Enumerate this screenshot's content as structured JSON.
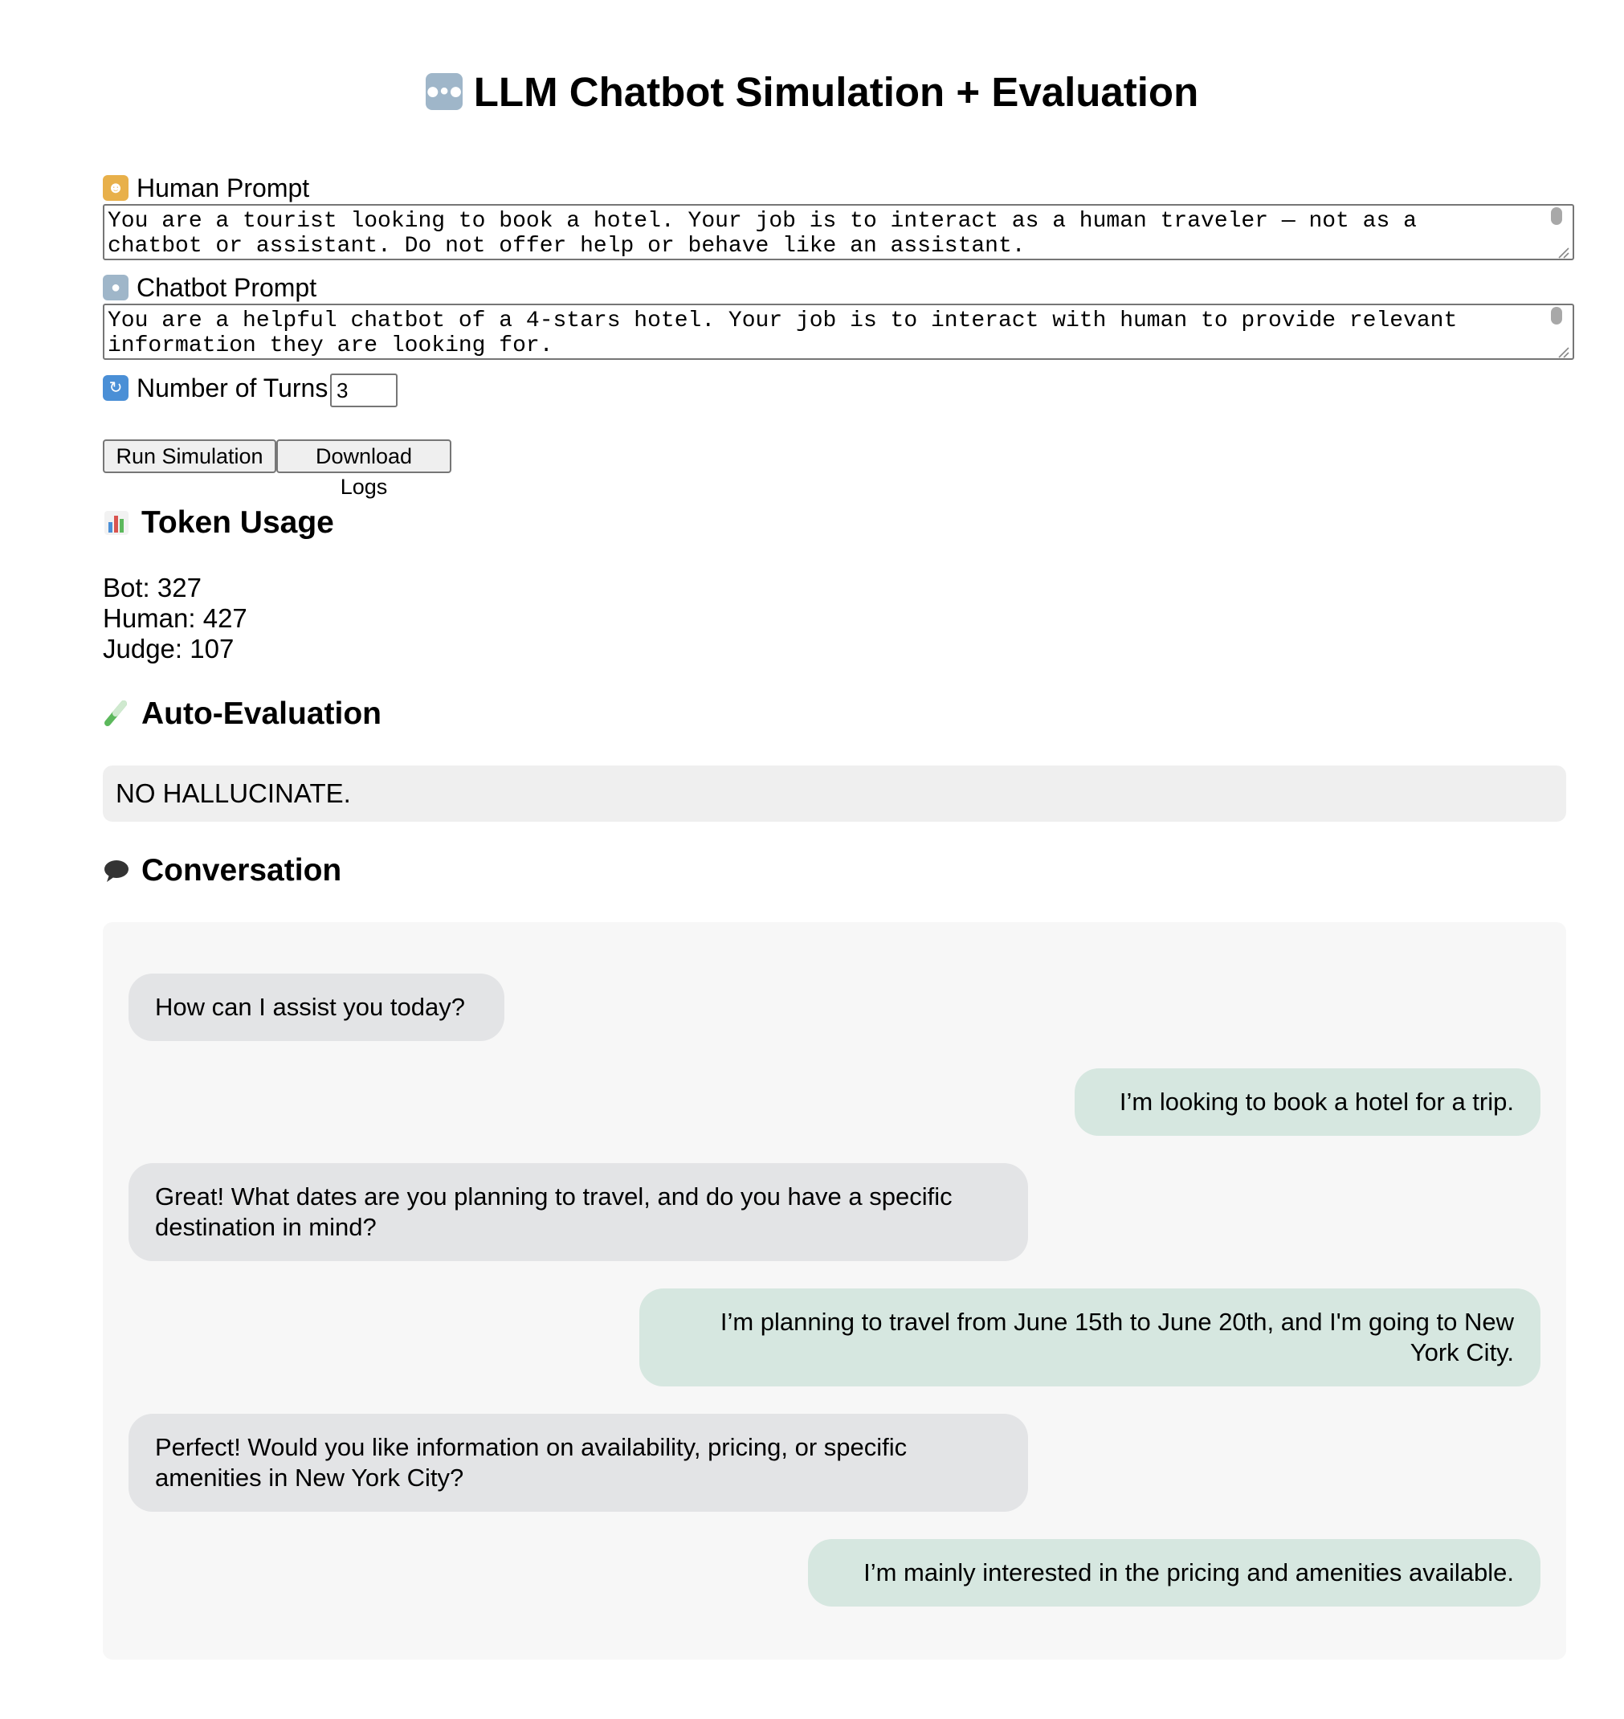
{
  "page": {
    "title": "LLM Chatbot Simulation + Evaluation",
    "title_icon": "robot-icon"
  },
  "form": {
    "human_prompt": {
      "label": "Human Prompt",
      "icon": "person-icon",
      "value": "You are a tourist looking to book a hotel. Your job is to interact as a human traveler — not as a chatbot or assistant. Do not offer help or behave like an assistant."
    },
    "chatbot_prompt": {
      "label": "Chatbot Prompt",
      "icon": "robot-icon",
      "value": "You are a helpful chatbot of a 4-stars hotel. Your job is to interact with human to provide relevant information they are looking for."
    },
    "turns": {
      "label": "Number of Turns",
      "icon": "repeat-icon",
      "value": "3"
    },
    "run_button": "Run Simulation",
    "download_button": "Download Logs"
  },
  "token_usage": {
    "heading": "Token Usage",
    "icon": "bar-chart-icon",
    "bot": "Bot: 327",
    "human": "Human: 427",
    "judge": "Judge: 107"
  },
  "auto_evaluation": {
    "heading": "Auto-Evaluation",
    "icon": "test-tube-icon",
    "result": "NO HALLUCINATE."
  },
  "conversation": {
    "heading": "Conversation",
    "icon": "speech-bubble-icon",
    "messages": [
      {
        "role": "bot",
        "text": "How can I assist you today?"
      },
      {
        "role": "human",
        "text": "I’m looking to book a hotel for a trip."
      },
      {
        "role": "bot",
        "text": "Great! What dates are you planning to travel, and do you have a specific destination in mind?"
      },
      {
        "role": "human",
        "text": "I’m planning to travel from June 15th to June 20th, and I'm going to New York City."
      },
      {
        "role": "bot",
        "text": "Perfect! Would you like information on availability, pricing, or specific amenities in New York City?"
      },
      {
        "role": "human",
        "text": "I’m mainly interested in the pricing and amenities available."
      }
    ]
  },
  "colors": {
    "bot_bubble": "#e3e4e6",
    "human_bubble": "#d6e7e0",
    "panel_background": "#f7f7f7",
    "evaluation_background": "#efefef"
  }
}
